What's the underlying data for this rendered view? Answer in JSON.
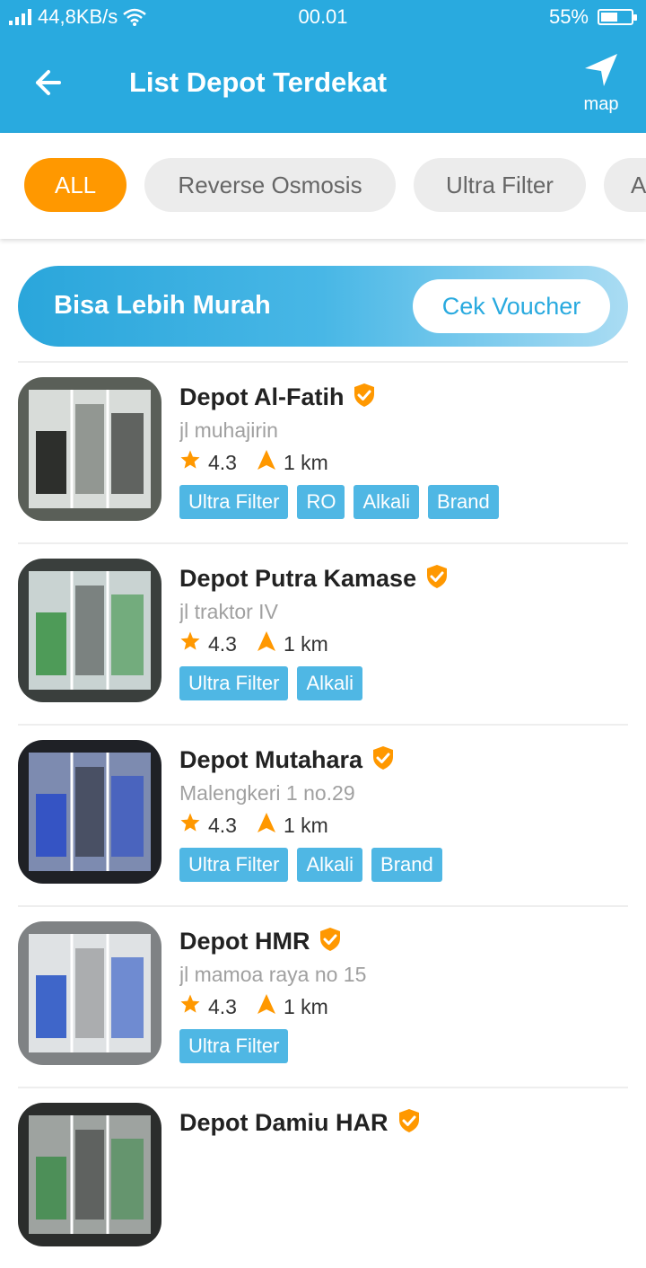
{
  "status_bar": {
    "speed": "44,8KB/s",
    "time": "00.01",
    "battery": "55%",
    "battery_level": 0.55
  },
  "app_bar": {
    "title": "List Depot Terdekat",
    "map_label": "map"
  },
  "filters": [
    {
      "label": "ALL",
      "active": true
    },
    {
      "label": "Reverse Osmosis",
      "active": false
    },
    {
      "label": "Ultra Filter",
      "active": false
    },
    {
      "label": "A",
      "active": false
    }
  ],
  "voucher": {
    "text": "Bisa Lebih Murah",
    "button": "Cek Voucher"
  },
  "depots": [
    {
      "name": "Depot Al-Fatih",
      "address": "jl muhajirin",
      "rating": "4.3",
      "distance": "1 km",
      "tags": [
        "Ultra Filter",
        "RO",
        "Alkali",
        "Brand"
      ]
    },
    {
      "name": "Depot Putra Kamase",
      "address": "jl traktor IV",
      "rating": "4.3",
      "distance": "1 km",
      "tags": [
        "Ultra Filter",
        "Alkali"
      ]
    },
    {
      "name": "Depot Mutahara",
      "address": "Malengkeri 1 no.29",
      "rating": "4.3",
      "distance": "1 km",
      "tags": [
        "Ultra Filter",
        "Alkali",
        "Brand"
      ]
    },
    {
      "name": "Depot HMR",
      "address": "jl mamoa raya no 15",
      "rating": "4.3",
      "distance": "1 km",
      "tags": [
        "Ultra Filter"
      ]
    },
    {
      "name": "Depot Damiu HAR",
      "address": "",
      "rating": "",
      "distance": "",
      "tags": []
    }
  ],
  "colors": {
    "primary": "#29aadf",
    "accent": "#ff9800",
    "tag": "#4fb7e4",
    "chip_bg": "#ececec"
  }
}
